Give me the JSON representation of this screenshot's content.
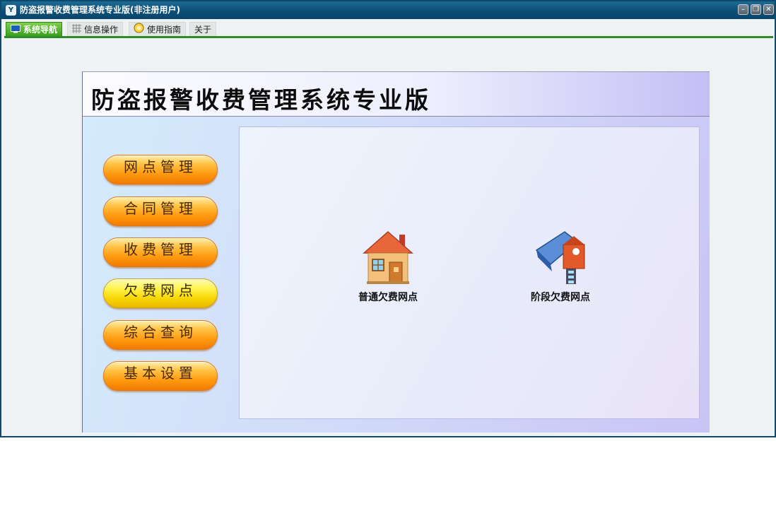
{
  "window": {
    "title": "防盗报警收费管理系统专业版(非注册用户)",
    "app_icon_glyph": "Y",
    "buttons": {
      "minimize": "–",
      "restore": "❐",
      "close": "✕"
    }
  },
  "tabs": [
    {
      "label": "系统导航",
      "icon": "monitor-icon",
      "active": true
    },
    {
      "label": "信息操作",
      "icon": "grid-icon",
      "active": false
    },
    {
      "label": "使用指南",
      "icon": "help-icon",
      "active": false
    },
    {
      "label": "关于",
      "icon": "",
      "active": false
    }
  ],
  "banner": {
    "title": "防盗报警收费管理系统专业版"
  },
  "sidebar": {
    "items": [
      {
        "label": "网点管理"
      },
      {
        "label": "合同管理"
      },
      {
        "label": "收费管理"
      },
      {
        "label": "欠费网点",
        "selected": true
      },
      {
        "label": "综合查询"
      },
      {
        "label": "基本设置"
      }
    ]
  },
  "panel": {
    "tiles": [
      {
        "label": "普通欠费网点",
        "icon": "house-icon"
      },
      {
        "label": "阶段欠费网点",
        "icon": "building-stage-icon"
      }
    ]
  },
  "colors": {
    "accent_green": "#2f8a2a",
    "title_bar": "#0d4f77",
    "button_orange": "#ff9a10",
    "button_yellow": "#f6d400"
  }
}
